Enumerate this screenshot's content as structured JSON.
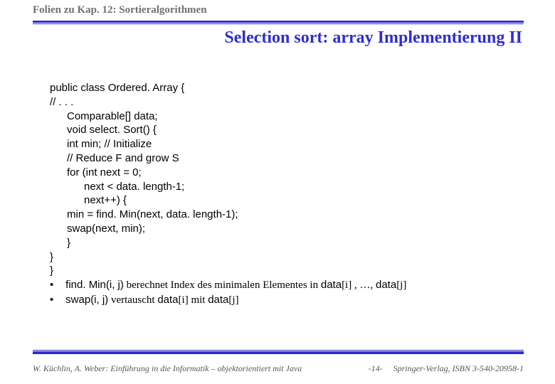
{
  "header": "Folien zu Kap. 12: Sortieralgorithmen",
  "title": "Selection sort: array Implementierung II",
  "code": {
    "l01": "public class Ordered. Array {",
    "l02": "// . . .",
    "l03": "Comparable[] data;",
    "l04": "void select. Sort() {",
    "l05": "int min; // Initialize",
    "l06": "// Reduce F and grow S",
    "l07": "for (int next = 0;",
    "l08": "next < data. length-1;",
    "l09": "next++) {",
    "l10": "min = find. Min(next, data. length-1);",
    "l11": "swap(next, min);",
    "l12": "}",
    "l13": "}",
    "l14": "}"
  },
  "notes": {
    "b1p1": "find. Min(i, j)",
    "b1p2": "  berechnet Index des minimalen Elementes in ",
    "b1p3": "data",
    "b1p4": "[i] , …, ",
    "b1p5": "data",
    "b1p6": "[j]",
    "b2p1": "swap(i, j)",
    "b2p2": "  vertauscht  ",
    "b2p3": "data",
    "b2p4": "[i]  mit  ",
    "b2p5": "data",
    "b2p6": "[j]"
  },
  "footer": {
    "left": "W. Küchlin, A. Weber: Einführung in die Informatik – objektorientiert mit Java",
    "page": "-14-",
    "right": "Springer-Verlag, ISBN 3-540-20958-1"
  }
}
